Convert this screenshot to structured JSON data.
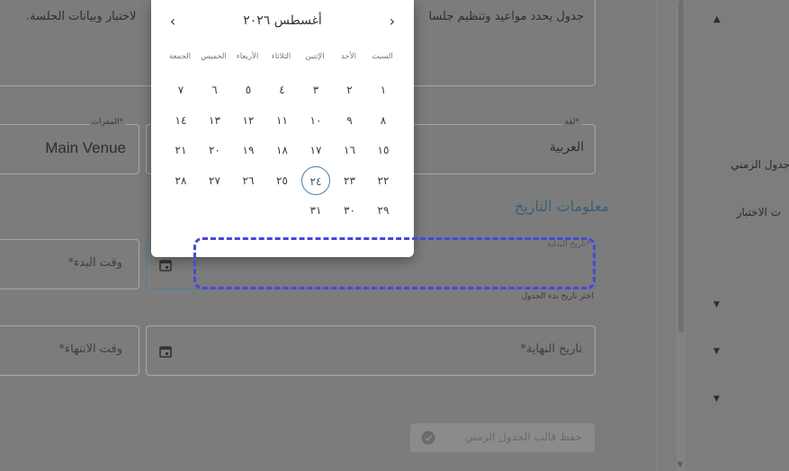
{
  "description": {
    "text_right": "جدول يحدد مواعيد وتنظيم جلسا",
    "text_left": "لاختبار وبيانات الجلسة."
  },
  "language_field": {
    "label": "لغة*",
    "value": "العربية"
  },
  "venue_field": {
    "label": "المقرات*",
    "value": "Main Venue"
  },
  "section_title": "معلومات التاريخ",
  "start_date": {
    "label": "تاريخ البداية*",
    "helper": "اختر تاريخ بدء الجدول"
  },
  "start_time": {
    "placeholder": "وقت البدء*"
  },
  "end_date": {
    "placeholder": "تاريخ النهاية*"
  },
  "end_time": {
    "placeholder": "وقت الانتهاء*"
  },
  "save_button": {
    "label": "حفظ قالب الجدول الزمني"
  },
  "sidebar": {
    "items": [
      {
        "label": "جدول الزمني"
      },
      {
        "label": "ت الاختبار"
      }
    ]
  },
  "calendar": {
    "month_title": "أغسطس ٢٠٢٦",
    "weekdays": [
      "السبت",
      "الأحد",
      "الإثنين",
      "الثلاثاء",
      "الأربعاء",
      "الخميس",
      "الجمعة"
    ],
    "weeks": [
      [
        "١",
        "٢",
        "٣",
        "٤",
        "٥",
        "٦",
        "٧"
      ],
      [
        "٨",
        "٩",
        "١٠",
        "١١",
        "١٢",
        "١٣",
        "١٤"
      ],
      [
        "١٥",
        "١٦",
        "١٧",
        "١٨",
        "١٩",
        "٢٠",
        "٢١"
      ],
      [
        "٢٢",
        "٢٣",
        "٢٤",
        "٢٥",
        "٢٦",
        "٢٧",
        "٢٨"
      ],
      [
        "٢٩",
        "٣٠",
        "٣١",
        "",
        "",
        "",
        ""
      ]
    ],
    "selected_day": "٢٤"
  },
  "colors": {
    "accent": "#4c7fa8",
    "focus_outline": "#4b47d8"
  }
}
